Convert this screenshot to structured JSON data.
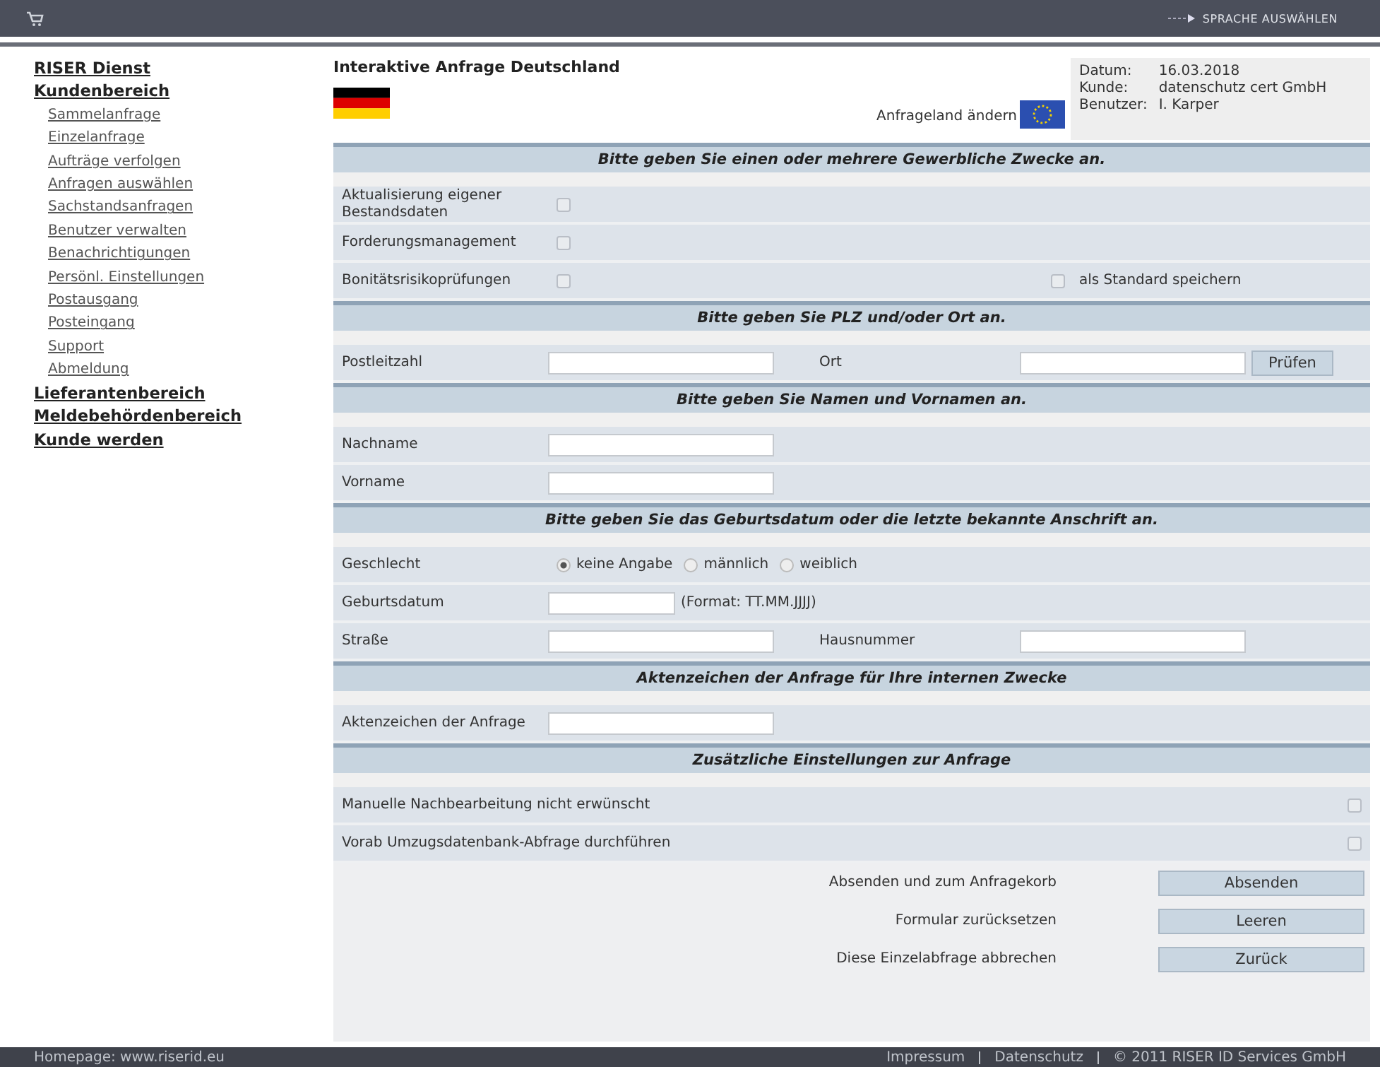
{
  "top_bar": {
    "language_link": "SPRACHE AUSWÄHLEN"
  },
  "sidebar": {
    "items": [
      {
        "label": "RISER Dienst"
      },
      {
        "label": "Kundenbereich",
        "children": [
          {
            "label": "Sammelanfrage"
          },
          {
            "label": "Einzelanfrage"
          },
          {
            "label": "Aufträge verfolgen"
          },
          {
            "label": "Anfragen auswählen"
          },
          {
            "label": "Sachstandsanfragen"
          },
          {
            "label": "Benutzer verwalten"
          },
          {
            "label": "Benachrichtigungen"
          },
          {
            "label": "Persönl. Einstellungen"
          },
          {
            "label": "Postausgang"
          },
          {
            "label": "Posteingang"
          },
          {
            "label": "Support"
          },
          {
            "label": "Abmeldung"
          }
        ]
      },
      {
        "label": "Lieferantenbereich"
      },
      {
        "label": "Meldebehördenbereich"
      },
      {
        "label": "Kunde werden"
      }
    ]
  },
  "header": {
    "title": "Interaktive Anfrage Deutschland",
    "country_change": "Anfrageland ändern",
    "info": [
      {
        "label": "Datum:",
        "value": "16.03.2018"
      },
      {
        "label": "Kunde:",
        "value": "datenschutz cert GmbH"
      },
      {
        "label": "Benutzer:",
        "value": "I. Karper"
      }
    ]
  },
  "sections": [
    {
      "title": "Bitte geben Sie einen oder mehrere Gewerbliche Zwecke an.",
      "rows": [
        {
          "kind": "checkbox",
          "label": "Aktualisierung eigener Bestandsdaten",
          "checked": false
        },
        {
          "kind": "checkbox",
          "label": "Forderungsmanagement",
          "checked": false
        },
        {
          "kind": "checkbox",
          "label": "Bonitätsrisikoprüfungen",
          "checked": false,
          "extra": {
            "label": "als Standard speichern",
            "checked": false
          }
        }
      ]
    },
    {
      "title": "Bitte geben Sie PLZ und/oder Ort an.",
      "rows": [
        {
          "kind": "fields",
          "label": "Postleitzahl",
          "label2": "Ort",
          "button": "Prüfen"
        }
      ]
    },
    {
      "title": "Bitte geben Sie Namen und Vornamen an.",
      "rows": [
        {
          "kind": "fields",
          "label": "Nachname"
        },
        {
          "kind": "fields",
          "label": "Vorname"
        }
      ]
    },
    {
      "title": "Bitte geben Sie das Geburtsdatum oder die letzte bekannte Anschrift an.",
      "rows": [
        {
          "kind": "radio",
          "label": "Geschlecht",
          "options": [
            {
              "label": "keine Angabe",
              "selected": true
            },
            {
              "label": "männlich",
              "selected": false
            },
            {
              "label": "weiblich",
              "selected": false
            }
          ]
        },
        {
          "kind": "date",
          "label": "Geburtsdatum",
          "hint": "(Format: TT.MM.JJJJ)"
        },
        {
          "kind": "fields",
          "label": "Straße",
          "label2": "Hausnummer"
        }
      ]
    },
    {
      "title": "Aktenzeichen der Anfrage für Ihre internen Zwecke",
      "rows": [
        {
          "kind": "fields",
          "label": "Aktenzeichen der Anfrage"
        }
      ]
    },
    {
      "title": "Zusätzliche Einstellungen zur Anfrage",
      "rows": [
        {
          "kind": "check_right",
          "label": "Manuelle Nachbearbeitung nicht erwünscht",
          "checked": false
        },
        {
          "kind": "check_right",
          "label": "Vorab Umzugsdatenbank-Abfrage durchführen",
          "checked": false
        }
      ]
    }
  ],
  "actions": [
    {
      "label": "Absenden und zum Anfragekorb",
      "button": "Absenden"
    },
    {
      "label": "Formular zurücksetzen",
      "button": "Leeren"
    },
    {
      "label": "Diese Einzelabfrage abbrechen",
      "button": "Zurück"
    }
  ],
  "footer": {
    "homepage": "Homepage: www.riserid.eu",
    "links": [
      "Impressum",
      "Datenschutz"
    ],
    "copyright": "© 2011 RISER ID Services GmbH"
  }
}
